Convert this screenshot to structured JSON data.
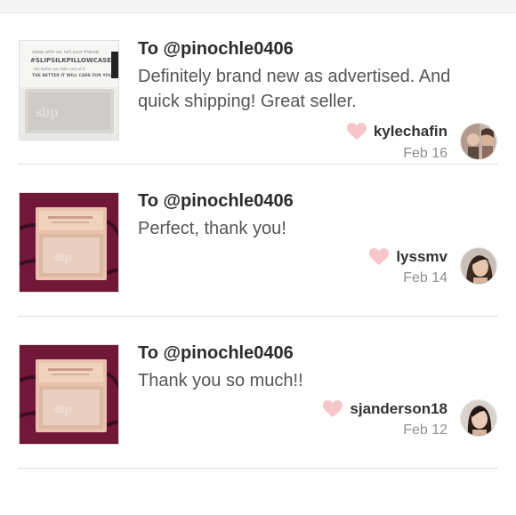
{
  "reviews": [
    {
      "to": "To @pinochle0406",
      "text": "Definitely brand new as advertised. And quick shipping! Great seller.",
      "author": "kylechafin",
      "date": "Feb 16",
      "thumb_caption": "#SLIPSILKPILLOWCASE",
      "thumb_brand": "slip"
    },
    {
      "to": "To @pinochle0406",
      "text": "Perfect, thank you!",
      "author": "lyssmv",
      "date": "Feb 14",
      "thumb_caption": "",
      "thumb_brand": "slip"
    },
    {
      "to": "To @pinochle0406",
      "text": "Thank you so much!!",
      "author": "sjanderson18",
      "date": "Feb 12",
      "thumb_caption": "",
      "thumb_brand": "slip"
    }
  ],
  "colors": {
    "heart": "#f7c6c9",
    "text_dark": "#2b2b2b",
    "text_body": "#555555",
    "text_muted": "#8f8f8f",
    "divider": "#dcdcdc"
  },
  "icons": {
    "heart": "heart-icon"
  }
}
